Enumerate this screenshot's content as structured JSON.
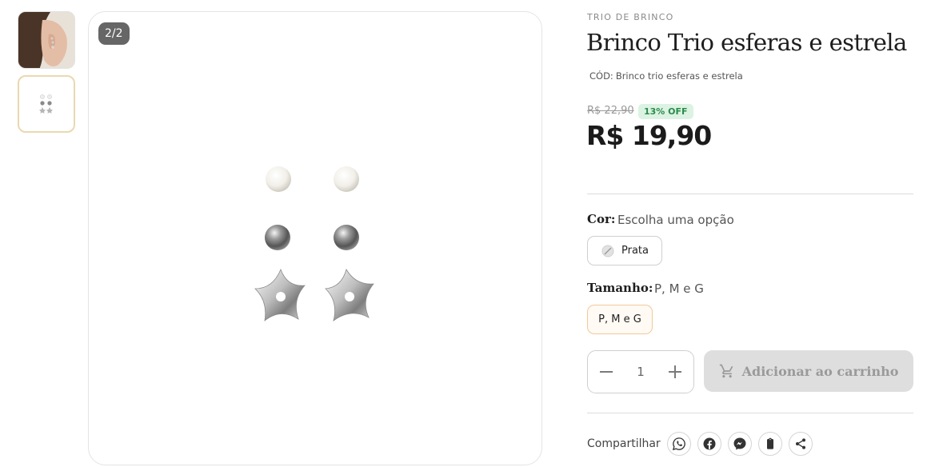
{
  "gallery": {
    "counter": "2/2",
    "thumbnails": [
      {
        "icon": "model-ear-photo-thumbnail"
      },
      {
        "icon": "earring-trio-thumbnail"
      }
    ]
  },
  "product": {
    "category": "TRIO DE BRINCO",
    "title": "Brinco Trio esferas e estrela",
    "sku_label": "CÓD:",
    "sku_value": "Brinco trio esferas e estrela",
    "old_price": "R$ 22,90",
    "discount": "13% OFF",
    "price": "R$ 19,90"
  },
  "options": {
    "color_label": "Cor:",
    "color_value": "Escolha uma opção",
    "color_choice": "Prata",
    "size_label": "Tamanho:",
    "size_value": "P, M e G",
    "size_choice": "P, M e G"
  },
  "cart": {
    "quantity": "1",
    "add_label": "Adicionar ao carrinho"
  },
  "share": {
    "label": "Compartilhar",
    "buttons": [
      "whatsapp-icon",
      "facebook-icon",
      "messenger-icon",
      "clipboard-icon",
      "share-icon"
    ]
  },
  "colors": {
    "badge_bg": "#dcf3e3",
    "badge_text": "#2a8b4a",
    "selected_chip_border": "#f2c89a",
    "disabled_button": "#dedede"
  }
}
